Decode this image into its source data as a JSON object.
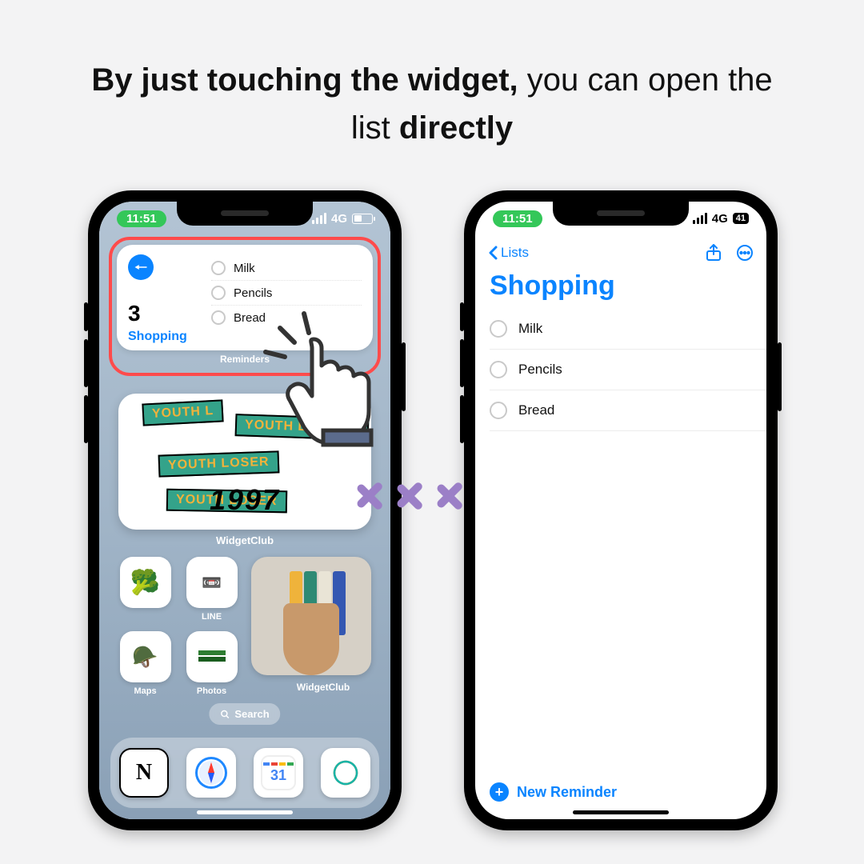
{
  "headline": {
    "bold1": "By just touching the widget,",
    "mid": " you can open the list ",
    "bold2": "directly"
  },
  "status": {
    "time": "11:51",
    "net": "4G",
    "batt": "41"
  },
  "widget": {
    "count": "3",
    "name": "Shopping",
    "label": "Reminders",
    "items": [
      "Milk",
      "Pencils",
      "Bread"
    ]
  },
  "widget2": {
    "tag1": "YOUTH L",
    "tag2": "YOUTH L  YOUTH",
    "tag3": "YOUTH   LOSER",
    "tag4": "YOUTH  LOSER",
    "year": "1997",
    "label": "WidgetClub"
  },
  "apps": {
    "a1": "",
    "a2": "LINE",
    "a3": "Maps",
    "a4": "Photos",
    "big": "WidgetClub"
  },
  "search": "Search",
  "dock": {
    "d1": "Notion",
    "d2": "Safari",
    "d3": "Calendar",
    "d4": "ChatGPT",
    "cal": "31"
  },
  "reminders": {
    "back": "Lists",
    "title": "Shopping",
    "items": [
      "Milk",
      "Pencils",
      "Bread"
    ],
    "new": "New Reminder"
  }
}
